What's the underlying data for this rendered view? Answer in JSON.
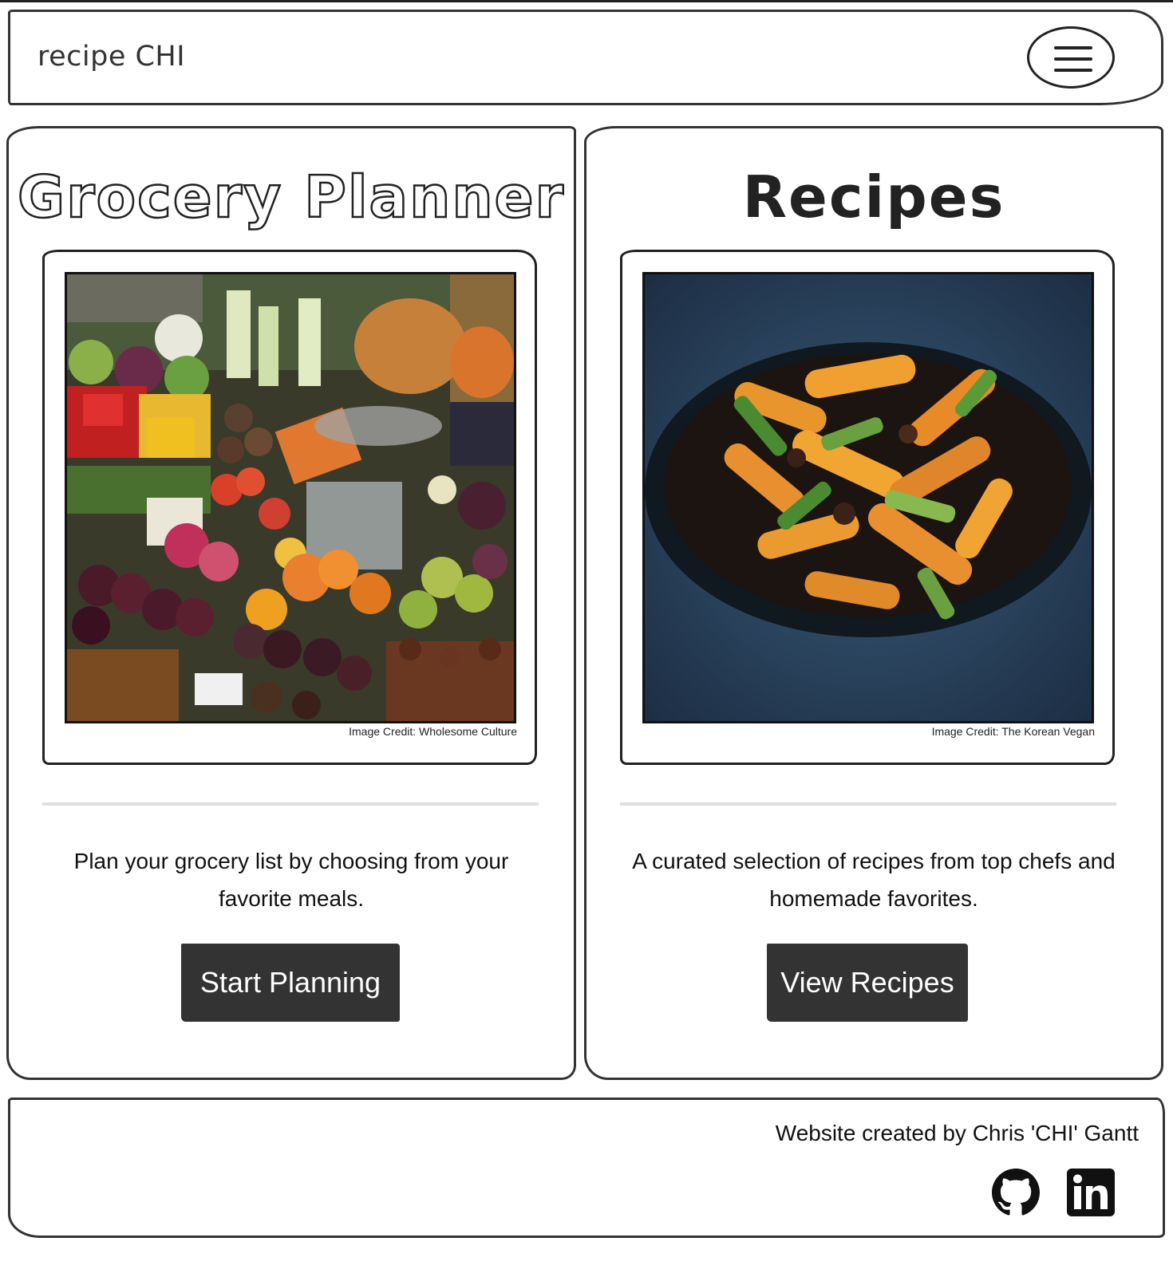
{
  "navbar": {
    "brand": "recipe CHI",
    "menu_icon": "hamburger-menu-icon"
  },
  "cards": [
    {
      "title": "Grocery Planner",
      "image_credit": "Image Credit: Wholesome Culture",
      "description": "Plan your grocery list by choosing from your favorite meals.",
      "button_label": "Start Planning"
    },
    {
      "title": "Recipes",
      "image_credit": "Image Credit: The Korean Vegan",
      "description": "A curated selection of recipes from top chefs and homemade favorites.",
      "button_label": "View Recipes"
    }
  ],
  "footer": {
    "credit": "Website created by Chris 'CHI' Gantt",
    "icons": [
      "github-icon",
      "linkedin-icon"
    ]
  },
  "colors": {
    "button_bg": "#333333",
    "border": "#333333",
    "divider": "#e0e0e0"
  }
}
